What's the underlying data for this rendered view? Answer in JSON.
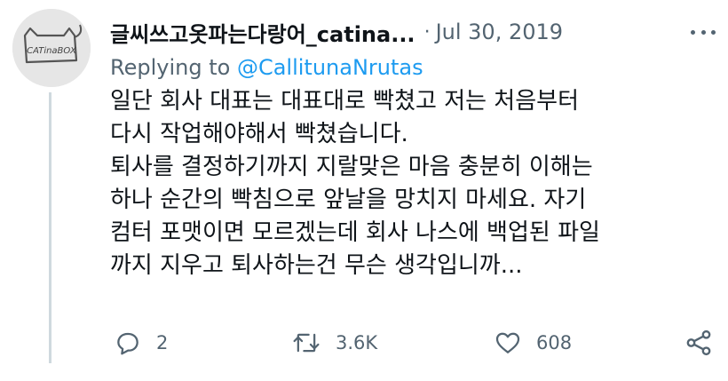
{
  "tweet": {
    "display_name": "글씨쓰고옷파는다랑어_catina...",
    "separator": "·",
    "date": "Jul 30, 2019",
    "replying_prefix": "Replying to",
    "replying_handle": "@CallitunaNrutas",
    "avatar_text": "CATinaBOX",
    "text_lines": [
      "일단 회사 대표는 대표대로 빡쳤고 저는 처음부터",
      "다시 작업해야해서 빡쳤습니다.",
      "퇴사를 결정하기까지 지랄맞은 마음 충분히 이해는",
      "하나 순간의 빡침으로 앞날을 망치지 마세요. 자기",
      "컴터 포맷이면 모르겠는데 회사 나스에 백업된 파일",
      "까지 지우고 퇴사하는건 무슨 생각입니까..."
    ],
    "stats": {
      "replies": "2",
      "retweets": "3.6K",
      "likes": "608"
    }
  },
  "colors": {
    "text_primary": "#0f1419",
    "text_secondary": "#536471",
    "link": "#1d9bf0",
    "thread_line": "#cfd9de"
  },
  "icons": {
    "avatar": "cat-in-box-logo",
    "more": "more-horizontal-icon",
    "reply": "reply-bubble-icon",
    "retweet": "retweet-icon",
    "like": "heart-icon",
    "share": "share-icon"
  }
}
